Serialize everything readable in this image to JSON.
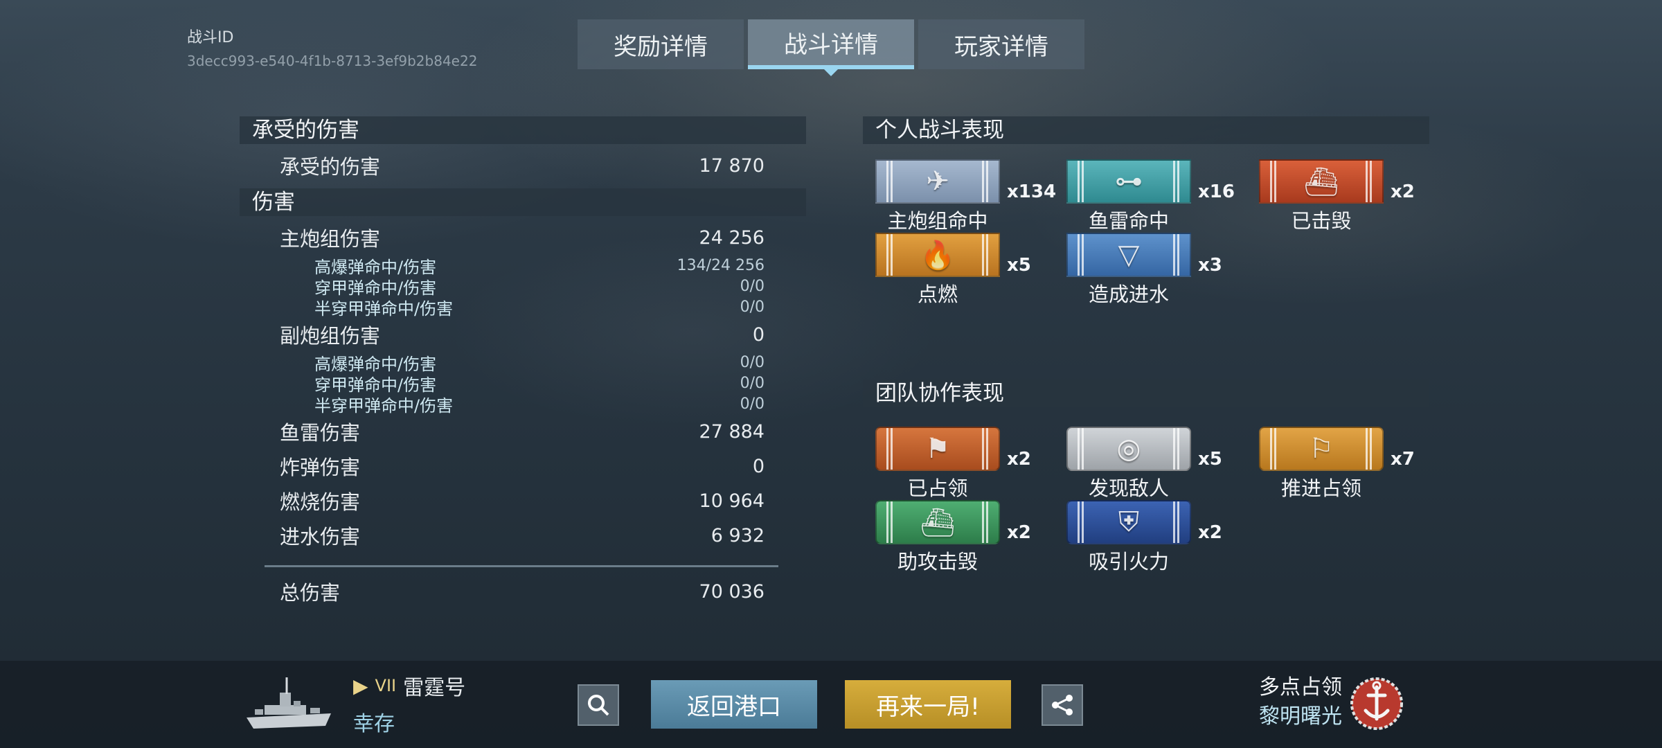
{
  "battle": {
    "id_label": "战斗ID",
    "id_value": "3decc993-e540-4f1b-8713-3ef9b2b84e22"
  },
  "tabs": [
    {
      "label": "奖励详情",
      "active": false
    },
    {
      "label": "战斗详情",
      "active": true
    },
    {
      "label": "玩家详情",
      "active": false
    }
  ],
  "received": {
    "section_title": "承受的伤害",
    "row": {
      "label": "承受的伤害",
      "value": "17 870"
    }
  },
  "damage": {
    "section_title": "伤害",
    "main_battery": {
      "label": "主炮组伤害",
      "value": "24 256",
      "sub": [
        {
          "label": "高爆弹命中/伤害",
          "value": "134/24 256"
        },
        {
          "label": "穿甲弹命中/伤害",
          "value": "0/0"
        },
        {
          "label": "半穿甲弹命中/伤害",
          "value": "0/0"
        }
      ]
    },
    "secondary": {
      "label": "副炮组伤害",
      "value": "0",
      "sub": [
        {
          "label": "高爆弹命中/伤害",
          "value": "0/0"
        },
        {
          "label": "穿甲弹命中/伤害",
          "value": "0/0"
        },
        {
          "label": "半穿甲弹命中/伤害",
          "value": "0/0"
        }
      ]
    },
    "torpedo": {
      "label": "鱼雷伤害",
      "value": "27 884"
    },
    "bomb": {
      "label": "炸弹伤害",
      "value": "0"
    },
    "fire": {
      "label": "燃烧伤害",
      "value": "10 964"
    },
    "flood": {
      "label": "进水伤害",
      "value": "6 932"
    },
    "total": {
      "label": "总伤害",
      "value": "70 036"
    }
  },
  "personal": {
    "section_title": "个人战斗表现",
    "ribbons": [
      {
        "name": "主炮组命中",
        "count": "x134",
        "color": "#8fa4bf",
        "icon": "shell-icon"
      },
      {
        "name": "鱼雷命中",
        "count": "x16",
        "color": "#3f9da3",
        "icon": "torpedo-icon"
      },
      {
        "name": "已击毁",
        "count": "x2",
        "color": "#c44a2a",
        "icon": "sinking-ship-icon"
      },
      {
        "name": "点燃",
        "count": "x5",
        "color": "#d28a2c",
        "icon": "fire-icon"
      },
      {
        "name": "造成进水",
        "count": "x3",
        "color": "#4a7cb8",
        "icon": "flood-icon"
      }
    ]
  },
  "team": {
    "section_title": "团队协作表现",
    "ribbons": [
      {
        "name": "已占领",
        "count": "x2",
        "color": "#c4612a",
        "icon": "flag-icon"
      },
      {
        "name": "发现敌人",
        "count": "x5",
        "color": "#b8bcc0",
        "icon": "spotting-icon"
      },
      {
        "name": "推进占领",
        "count": "x7",
        "color": "#cf8f2c",
        "icon": "capture-contribution-icon"
      },
      {
        "name": "助攻击毁",
        "count": "x2",
        "color": "#3f9c62",
        "icon": "assist-icon"
      },
      {
        "name": "吸引火力",
        "count": "x2",
        "color": "#2b4f9a",
        "icon": "tank-damage-icon"
      }
    ]
  },
  "footer": {
    "ship_tier": "VII",
    "ship_name": "雷霆号",
    "status": "幸存",
    "return_label": "返回港口",
    "again_label": "再来一局!",
    "mode": "多点占领",
    "map": "黎明曙光"
  }
}
